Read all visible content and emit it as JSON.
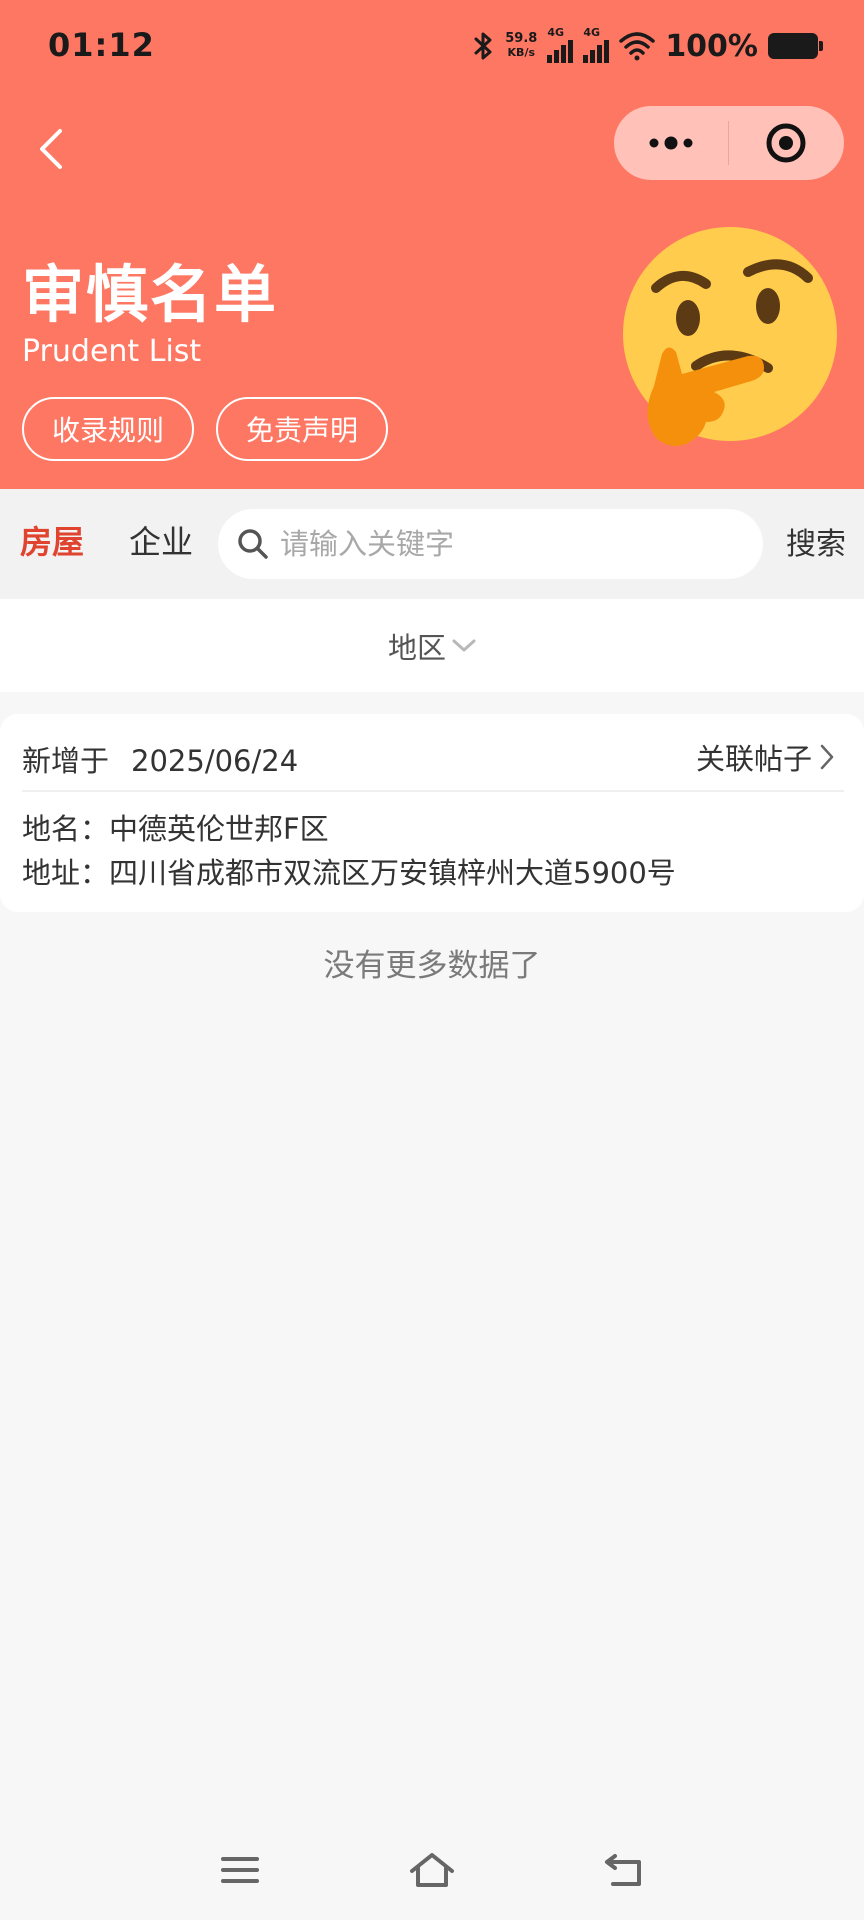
{
  "status_bar": {
    "time": "01:12",
    "net_speed_value": "59.8",
    "net_speed_unit": "KB/s",
    "sim1": "4G",
    "sim2": "4G",
    "battery": "100%"
  },
  "header": {
    "title": "审慎名单",
    "subtitle": "Prudent List",
    "buttons": [
      "收录规则",
      "免责声明"
    ],
    "background": "#fe7763"
  },
  "tabs": [
    {
      "label": "房屋",
      "active": true
    },
    {
      "label": "企业",
      "active": false
    }
  ],
  "search": {
    "placeholder": "请输入关键字",
    "value": "",
    "button": "搜索"
  },
  "filter": {
    "label": "地区"
  },
  "records": [
    {
      "added_label": "新增于",
      "date": "2025/06/24",
      "link_label": "关联帖子",
      "name": "地名：中德英伦世邦F区",
      "address": "地址：四川省成都市双流区万安镇梓州大道5900号"
    }
  ],
  "footer_text": "没有更多数据了",
  "colors": {
    "accent": "#e0432e",
    "header_bg": "#fe7763"
  },
  "icons": [
    "bluetooth-icon",
    "wifi-icon",
    "battery-icon",
    "back-icon",
    "more-icon",
    "target-icon",
    "thinking-face-emoji",
    "search-icon",
    "chevron-down-icon",
    "chevron-right-icon",
    "menu-icon",
    "home-icon",
    "return-icon"
  ]
}
